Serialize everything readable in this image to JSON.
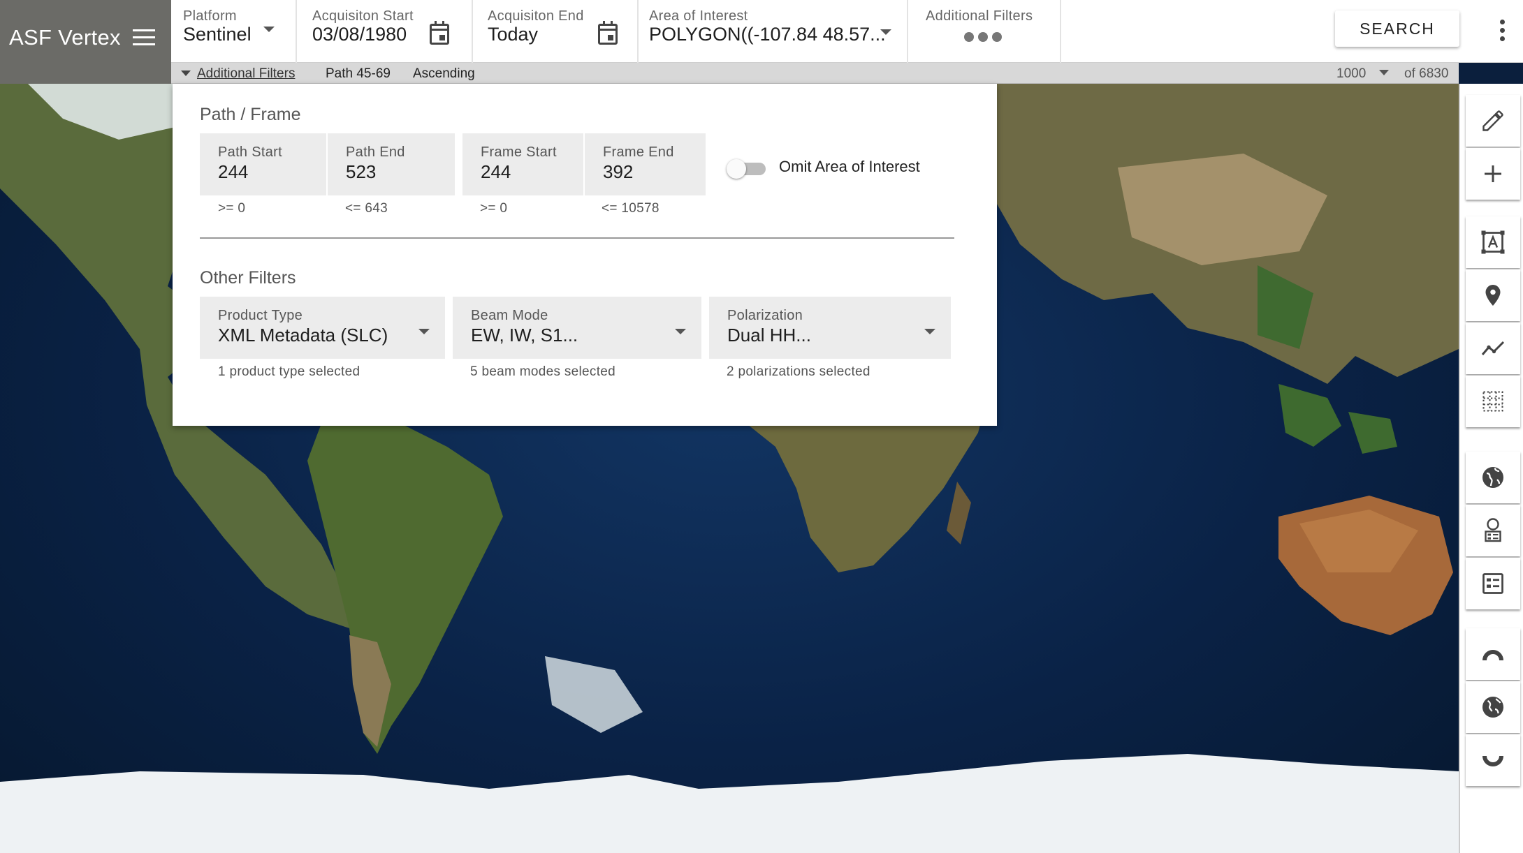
{
  "app": {
    "title": "ASF Vertex"
  },
  "toolbar": {
    "platform": {
      "label": "Platform",
      "value": "Sentinel"
    },
    "acq_start": {
      "label": "Acquisiton Start",
      "value": "03/08/1980"
    },
    "acq_end": {
      "label": "Acquisiton End",
      "value": "Today"
    },
    "aoi": {
      "label": "Area of Interest",
      "value": "POLYGON((-107.84 48.57..."
    },
    "additional": {
      "label": "Additional Filters"
    },
    "search_label": "SEARCH"
  },
  "subbar": {
    "additional_filters": "Additional Filters",
    "path": "Path 45-69",
    "direction": "Ascending",
    "max_results": "1000",
    "of_total": "of 6830"
  },
  "panel": {
    "path_frame_title": "Path / Frame",
    "path_start": {
      "label": "Path Start",
      "value": "244",
      "hint": ">= 0"
    },
    "path_end": {
      "label": "Path End",
      "value": "523",
      "hint": "<= 643"
    },
    "frame_start": {
      "label": "Frame Start",
      "value": "244",
      "hint": ">= 0"
    },
    "frame_end": {
      "label": "Frame End",
      "value": "392",
      "hint": "<= 10578"
    },
    "omit_aoi": {
      "label": "Omit Area of Interest",
      "checked": false
    },
    "other_title": "Other Filters",
    "product_type": {
      "label": "Product Type",
      "value": "XML Metadata (SLC)",
      "hint": "1 product type selected"
    },
    "beam_mode": {
      "label": "Beam Mode",
      "value": "EW, IW, S1...",
      "hint": "5 beam modes selected"
    },
    "polarization": {
      "label": "Polarization",
      "value": "Dual HH...",
      "hint": "2 polarizations selected"
    }
  },
  "rail": {
    "tools": [
      "pencil-icon",
      "plus-icon",
      "box-draw-icon",
      "point-icon",
      "linestring-icon",
      "grid-icon",
      "globe-icon",
      "globe-list-icon",
      "list-icon",
      "arctic-icon",
      "equatorial-globe-icon",
      "antarctic-icon"
    ]
  },
  "colors": {
    "brand_bg": "#6b6b67",
    "ocean": "#0a2246",
    "land": "#7a6a45",
    "ice": "#eef2f4"
  }
}
